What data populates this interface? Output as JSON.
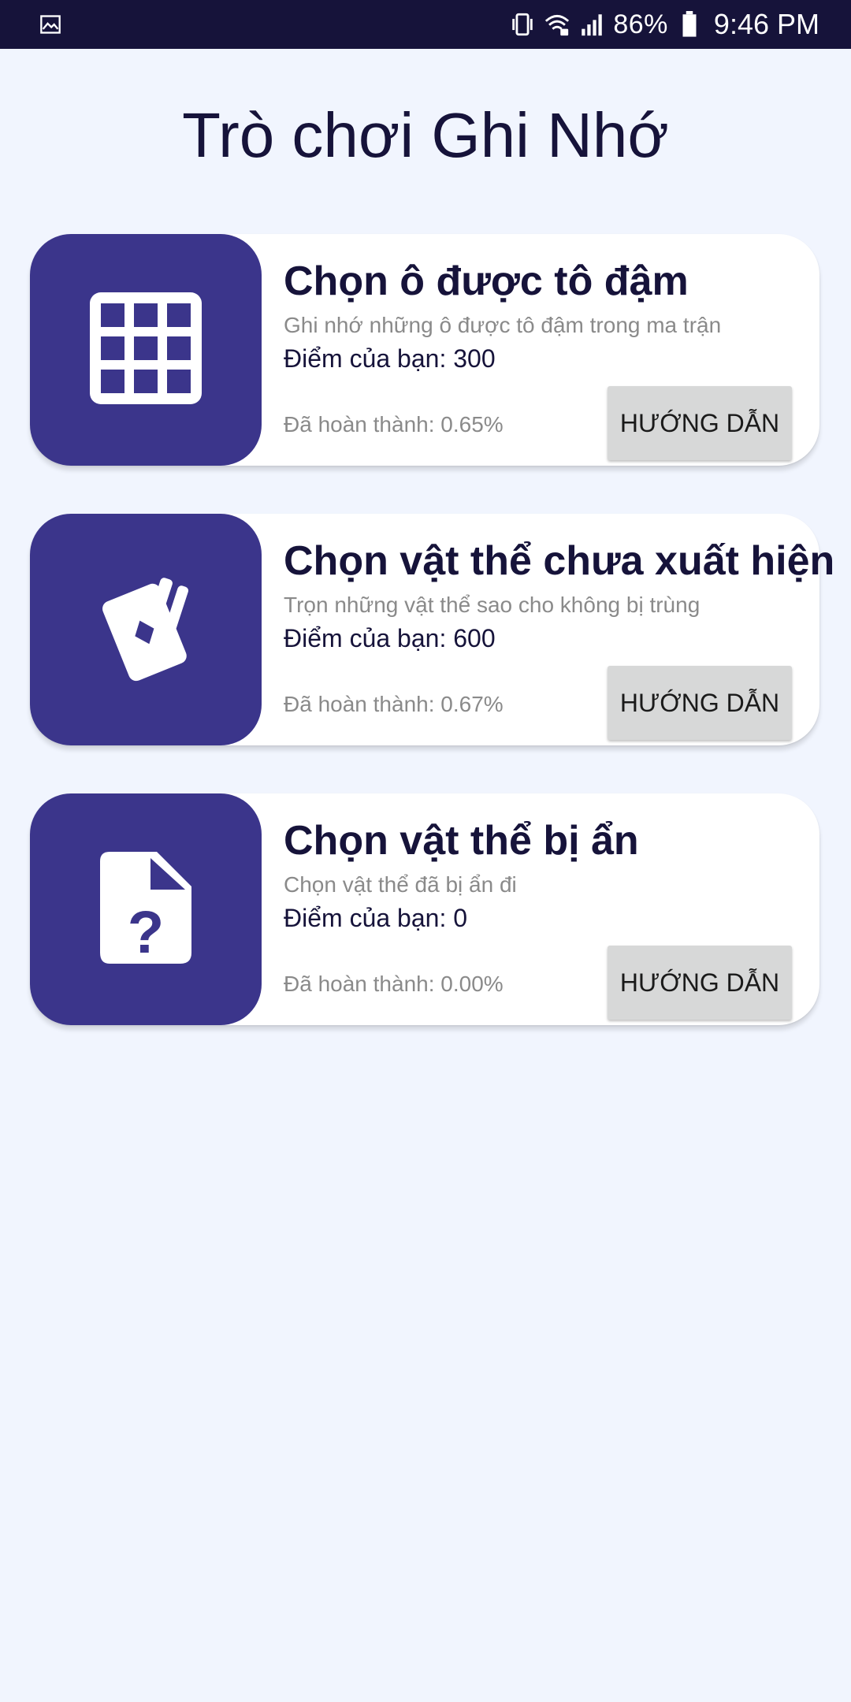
{
  "status_bar": {
    "left_icon": "image-icon",
    "icons": [
      "vibrate-icon",
      "wifi-icon",
      "signal-icon"
    ],
    "battery_percent": "86%",
    "time": "9:46 PM",
    "background_color": "#16133a"
  },
  "page": {
    "title": "Trò chơi Ghi Nhớ",
    "background_color": "#f1f5fe",
    "accent_color": "#3b358b"
  },
  "games": [
    {
      "icon": "grid-icon",
      "title": "Chọn ô được tô đậm",
      "description": "Ghi nhớ những ô được tô đậm trong ma trận",
      "score": "Điểm của bạn: 300",
      "progress": "Đã hoàn thành: 0.65%",
      "button_label": "HƯỚNG DẪN"
    },
    {
      "icon": "cards-icon",
      "title": "Chọn vật thể chưa xuất hiện",
      "description": "Trọn những vật thể sao cho không bị trùng",
      "score": "Điểm của bạn: 600",
      "progress": "Đã hoàn thành: 0.67%",
      "button_label": "HƯỚNG DẪN"
    },
    {
      "icon": "unknown-file-icon",
      "title": "Chọn vật thể bị ẩn",
      "description": "Chọn vật thể đã bị ẩn đi",
      "score": "Điểm của bạn: 0",
      "progress": "Đã hoàn thành: 0.00%",
      "button_label": "HƯỚNG DẪN"
    }
  ]
}
